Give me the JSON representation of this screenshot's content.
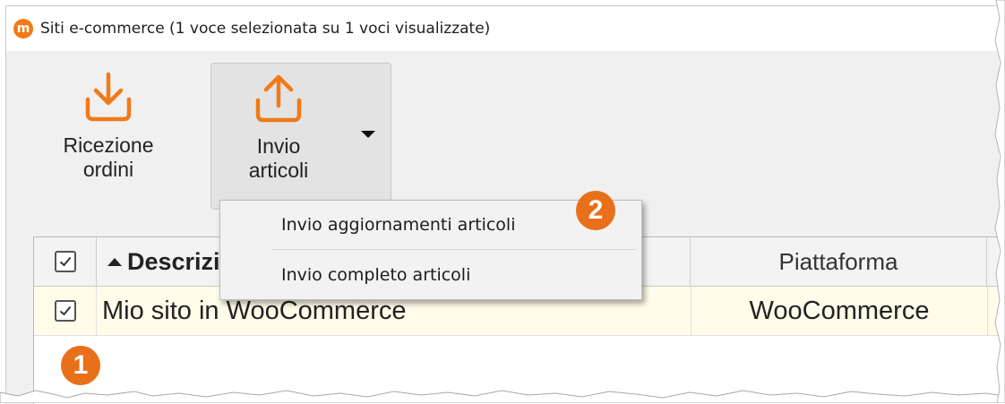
{
  "window": {
    "title": "Siti e-commerce (1 voce selezionata su 1 voci visualizzate)",
    "app_icon_letter": "m",
    "app_icon_color": "#f47a15"
  },
  "ribbon": {
    "receive_button": {
      "line1": "Ricezione",
      "line2": "ordini",
      "icon": "download-icon"
    },
    "send_button": {
      "line1": "Invio",
      "line2": "articoli",
      "icon": "upload-icon"
    },
    "icon_color": "#f07a1a"
  },
  "dropdown_menu": {
    "items": [
      {
        "label": "Invio aggiornamenti articoli"
      },
      {
        "label": "Invio completo articoli"
      }
    ]
  },
  "grid": {
    "columns": [
      {
        "label": "Descrizione",
        "sort": "ascending"
      },
      {
        "label": "Piattaforma"
      }
    ],
    "rows": [
      {
        "checked": true,
        "description": "Mio sito in WooCommerce",
        "platform": "WooCommerce"
      }
    ],
    "row_highlight_color": "#fffcea"
  },
  "callouts": [
    {
      "number": "1"
    },
    {
      "number": "2"
    }
  ],
  "accent_color": "#e8701a"
}
